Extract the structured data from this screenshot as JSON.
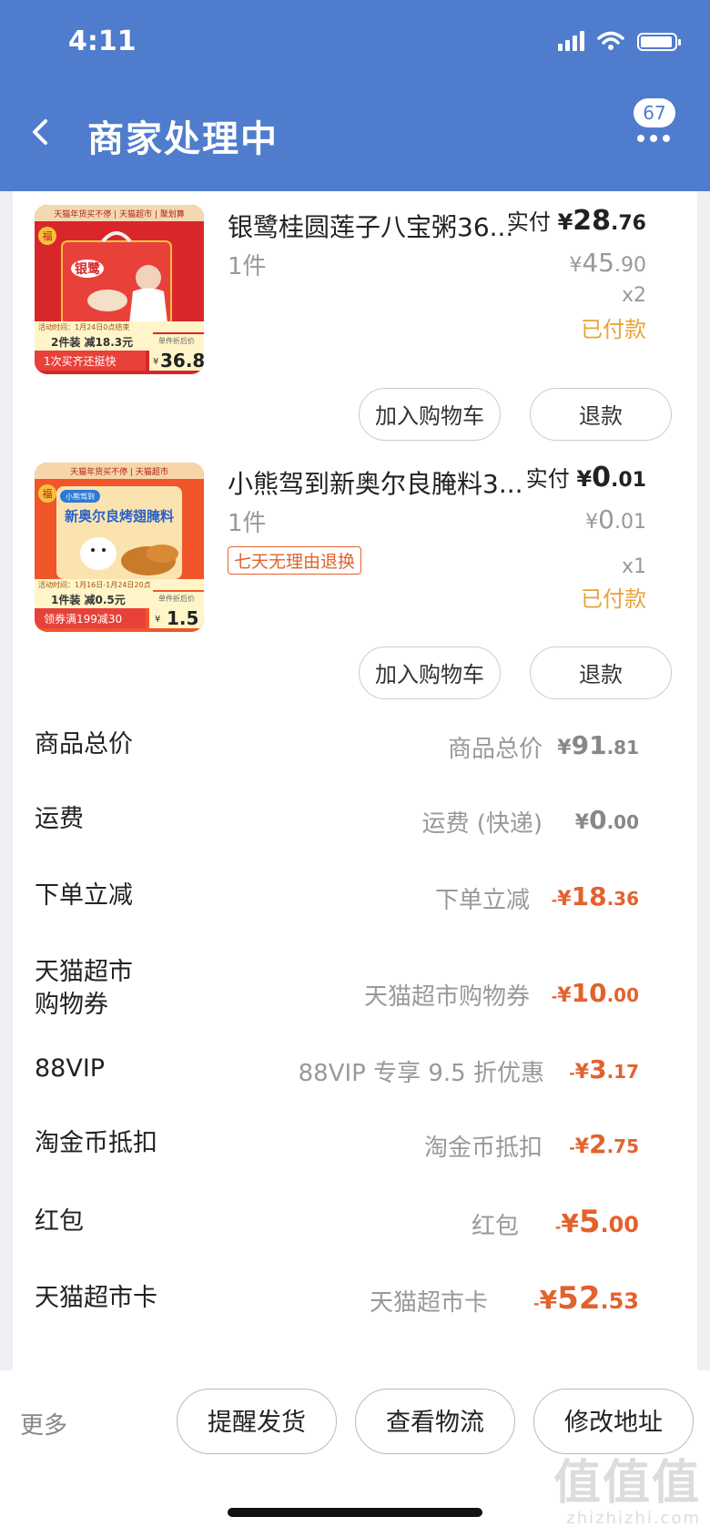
{
  "status_bar": {
    "time": "4:11"
  },
  "header": {
    "title": "商家处理中",
    "badge_count": "67"
  },
  "items": [
    {
      "name": "银鹭桂圆莲子八宝粥36...",
      "quantity": "1件",
      "paid_label": "实付",
      "paid_yen": "¥",
      "paid_int": "28",
      "paid_dec": ".76",
      "orig_yen": "¥",
      "orig_int": "45",
      "orig_dec": ".90",
      "multiplier": "x2",
      "status": "已付款",
      "add_cart": "加入购物车",
      "refund": "退款",
      "thumb": {
        "top_banner": "天猫年货买不停 | 天猫超市 | 聚划算",
        "fu": "福",
        "brand": "银鹭",
        "promo_date": "活动时间：1月24日0点结束",
        "promo_line": "2件装 减18.3元",
        "promo_line2": "1次买齐还挺快",
        "unit_label": "单件折后价",
        "unit_yen": "¥",
        "unit_price": "36.8"
      }
    },
    {
      "name": "小熊驾到新奥尔良腌料3...",
      "quantity": "1件",
      "tag": "七天无理由退换",
      "paid_label": "实付",
      "paid_yen": "¥",
      "paid_int": "0",
      "paid_dec": ".01",
      "orig_yen": "¥",
      "orig_int": "0",
      "orig_dec": ".01",
      "multiplier": "x1",
      "status": "已付款",
      "add_cart": "加入购物车",
      "refund": "退款",
      "thumb": {
        "top_banner": "天猫年货买不停 | 天猫超市",
        "fu": "福",
        "brand": "小熊驾到",
        "product_text": "新奥尔良烤翅腌料",
        "promo_date": "活动时间：1月16日-1月24日20点",
        "promo_line": "1件装 减0.5元",
        "promo_line2": "领券满199减30",
        "unit_label": "单件折后价",
        "unit_yen": "¥",
        "unit_price": "1.5"
      }
    }
  ],
  "summary": [
    {
      "label": "商品总价",
      "desc": "商品总价",
      "sign": "",
      "yen": "¥",
      "int": "91",
      "dec": ".81",
      "tone": "gray"
    },
    {
      "label": "运费",
      "desc": "运费 (快递)",
      "sign": "",
      "yen": "¥",
      "int": "0",
      "dec": ".00",
      "tone": "gray"
    },
    {
      "label": "下单立减",
      "desc": "下单立减",
      "sign": "-",
      "yen": "¥",
      "int": "18",
      "dec": ".36",
      "tone": "red"
    },
    {
      "label": "天猫超市\n购物券",
      "desc": "天猫超市购物券",
      "sign": "-",
      "yen": "¥",
      "int": "10",
      "dec": ".00",
      "tone": "red"
    },
    {
      "label": "88VIP",
      "desc": "88VIP 专享 9.5 折优惠",
      "sign": "-",
      "yen": "¥",
      "int": "3",
      "dec": ".17",
      "tone": "red"
    },
    {
      "label": "淘金币抵扣",
      "desc": "淘金币抵扣",
      "sign": "-",
      "yen": "¥",
      "int": "2",
      "dec": ".75",
      "tone": "red"
    },
    {
      "label": "红包",
      "desc": "红包",
      "sign": "-",
      "yen": "¥",
      "int": "5",
      "dec": ".00",
      "tone": "red",
      "size": "large"
    },
    {
      "label": "天猫超市卡",
      "desc": "天猫超市卡",
      "sign": "-",
      "yen": "¥",
      "int": "52",
      "dec": ".53",
      "tone": "red",
      "size": "large"
    }
  ],
  "bottom_bar": {
    "more": "更多",
    "remind": "提醒发货",
    "logistics": "查看物流",
    "address": "修改地址"
  },
  "watermark": {
    "big": "值值值",
    "small": "zhizhizhi.com"
  }
}
